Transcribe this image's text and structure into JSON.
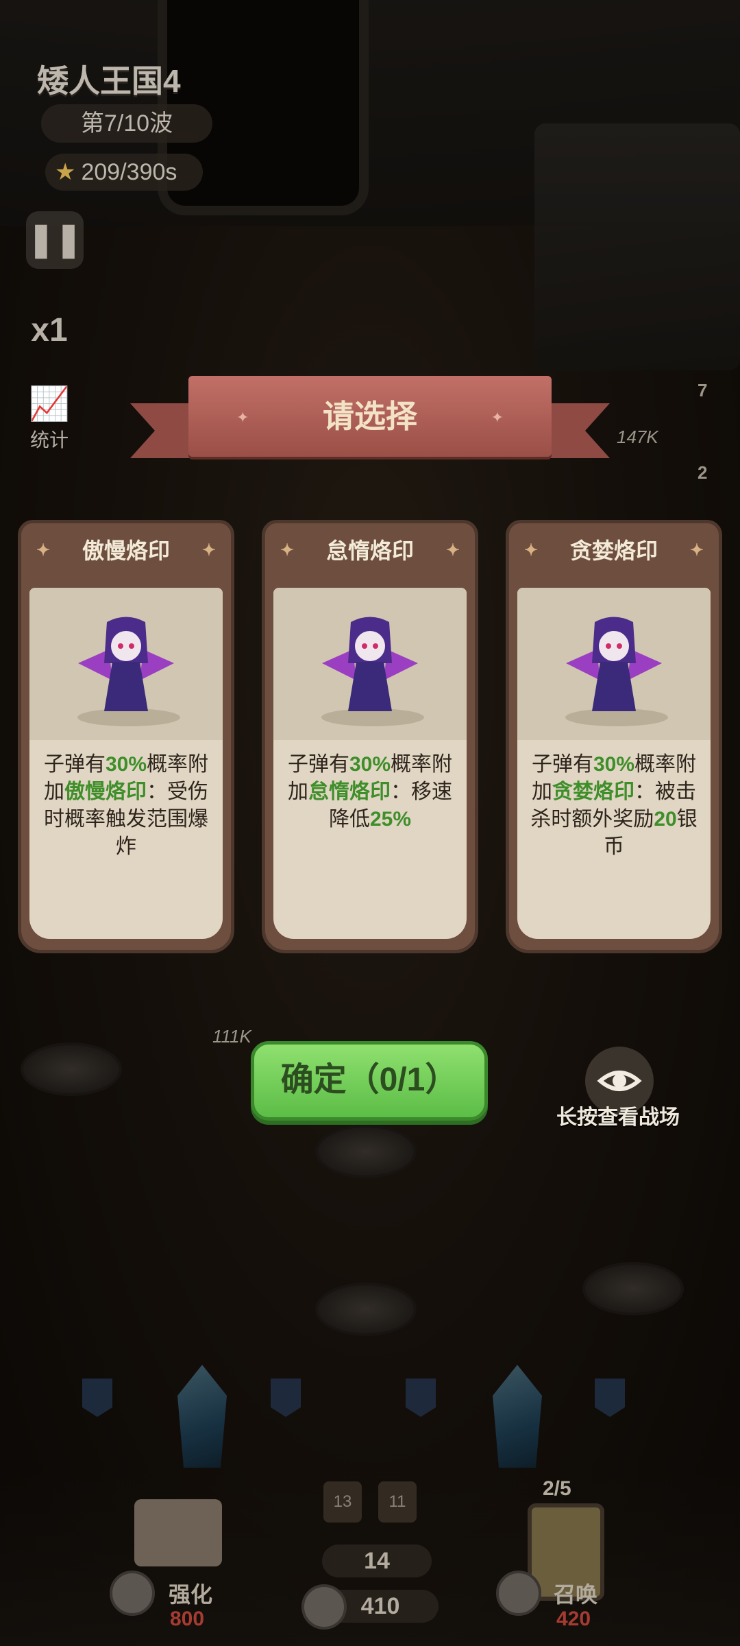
{
  "hud": {
    "level_title": "矮人王国4",
    "wave": "第7/10波",
    "stars": "209/390s",
    "pause_icon": "pause-icon",
    "speed": "x1",
    "stats_label": "统计"
  },
  "battlefield": {
    "hp_labels": [
      "147K",
      "111K"
    ],
    "badge_numbers": [
      "7",
      "2"
    ]
  },
  "dialog": {
    "title": "请选择",
    "cards": [
      {
        "name": "傲慢烙印",
        "desc_parts": [
          "子弹有",
          "30%",
          "概率附加",
          "傲慢烙印",
          "：受伤时概率触发范围爆炸"
        ]
      },
      {
        "name": "怠惰烙印",
        "desc_parts": [
          "子弹有",
          "30%",
          "概率附加",
          "怠惰烙印",
          "：移速降低",
          "25%"
        ]
      },
      {
        "name": "贪婪烙印",
        "desc_parts": [
          "子弹有",
          "30%",
          "概率附加",
          "贪婪烙印",
          "：被击杀时额外奖励",
          "20",
          "银币"
        ]
      }
    ],
    "confirm": "确定（0/1）",
    "long_press_label": "长按查看战场"
  },
  "bottom_bar": {
    "upgrade_label": "强化",
    "upgrade_cost": "800",
    "crystals": "14",
    "silver": "410",
    "summon_label": "召唤",
    "summon_cost": "420",
    "summon_count": "2/5",
    "slot_1": "13",
    "slot_2": "11"
  },
  "colors": {
    "highlight_green": "#3e8e2a",
    "confirm_green": "#5cbd47",
    "banner_red": "#b0605a",
    "card_frame": "#6e4f3f"
  }
}
